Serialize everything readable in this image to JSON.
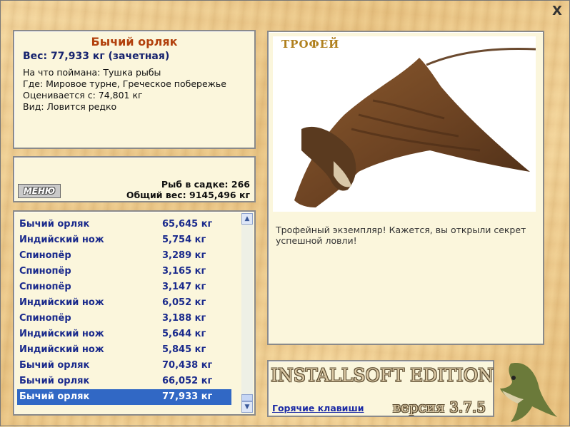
{
  "window": {
    "close_glyph": "X"
  },
  "catch": {
    "name": "Бычий орляк",
    "weight": "Вес: 77,933 кг (зачетная)",
    "bait": "На что поймана: Тушка рыбы",
    "location": "Где: Мировое турне, Греческое побережье",
    "value": "Оценивается с: 74,801 кг",
    "kind": "Вид: Ловится редко"
  },
  "status": {
    "menu_label": "МЕНЮ",
    "fish_count": "Рыб в садке: 266",
    "total_weight": "Общий вес: 9145,496 кг"
  },
  "catch_list": [
    {
      "name": "Бычий орляк",
      "weight": "65,645 кг"
    },
    {
      "name": "Индийский нож",
      "weight": "5,754 кг"
    },
    {
      "name": "Спинопёр",
      "weight": "3,289 кг"
    },
    {
      "name": "Спинопёр",
      "weight": "3,165 кг"
    },
    {
      "name": "Спинопёр",
      "weight": "3,147 кг"
    },
    {
      "name": "Индийский нож",
      "weight": "6,052 кг"
    },
    {
      "name": "Спинопёр",
      "weight": "3,188 кг"
    },
    {
      "name": "Индийский нож",
      "weight": "5,644 кг"
    },
    {
      "name": "Индийский нож",
      "weight": "5,845 кг"
    },
    {
      "name": "Бычий орляк",
      "weight": "70,438 кг"
    },
    {
      "name": "Бычий орляк",
      "weight": "66,052 кг"
    },
    {
      "name": "Бычий орляк",
      "weight": "77,933 кг"
    }
  ],
  "selected_index": 11,
  "trophy": {
    "title": "ТРОФЕЙ",
    "description": "Трофейный экземпляр! Кажется, вы открыли секрет успешной ловли!"
  },
  "brand": {
    "edition": "INSTALLSOFT EDITION",
    "hotkeys": "Горячие клавиши",
    "version": "версия 3.7.5"
  },
  "colors": {
    "selection": "#3168c5",
    "list_text": "#1a2a8c",
    "title_accent": "#b2410d"
  }
}
